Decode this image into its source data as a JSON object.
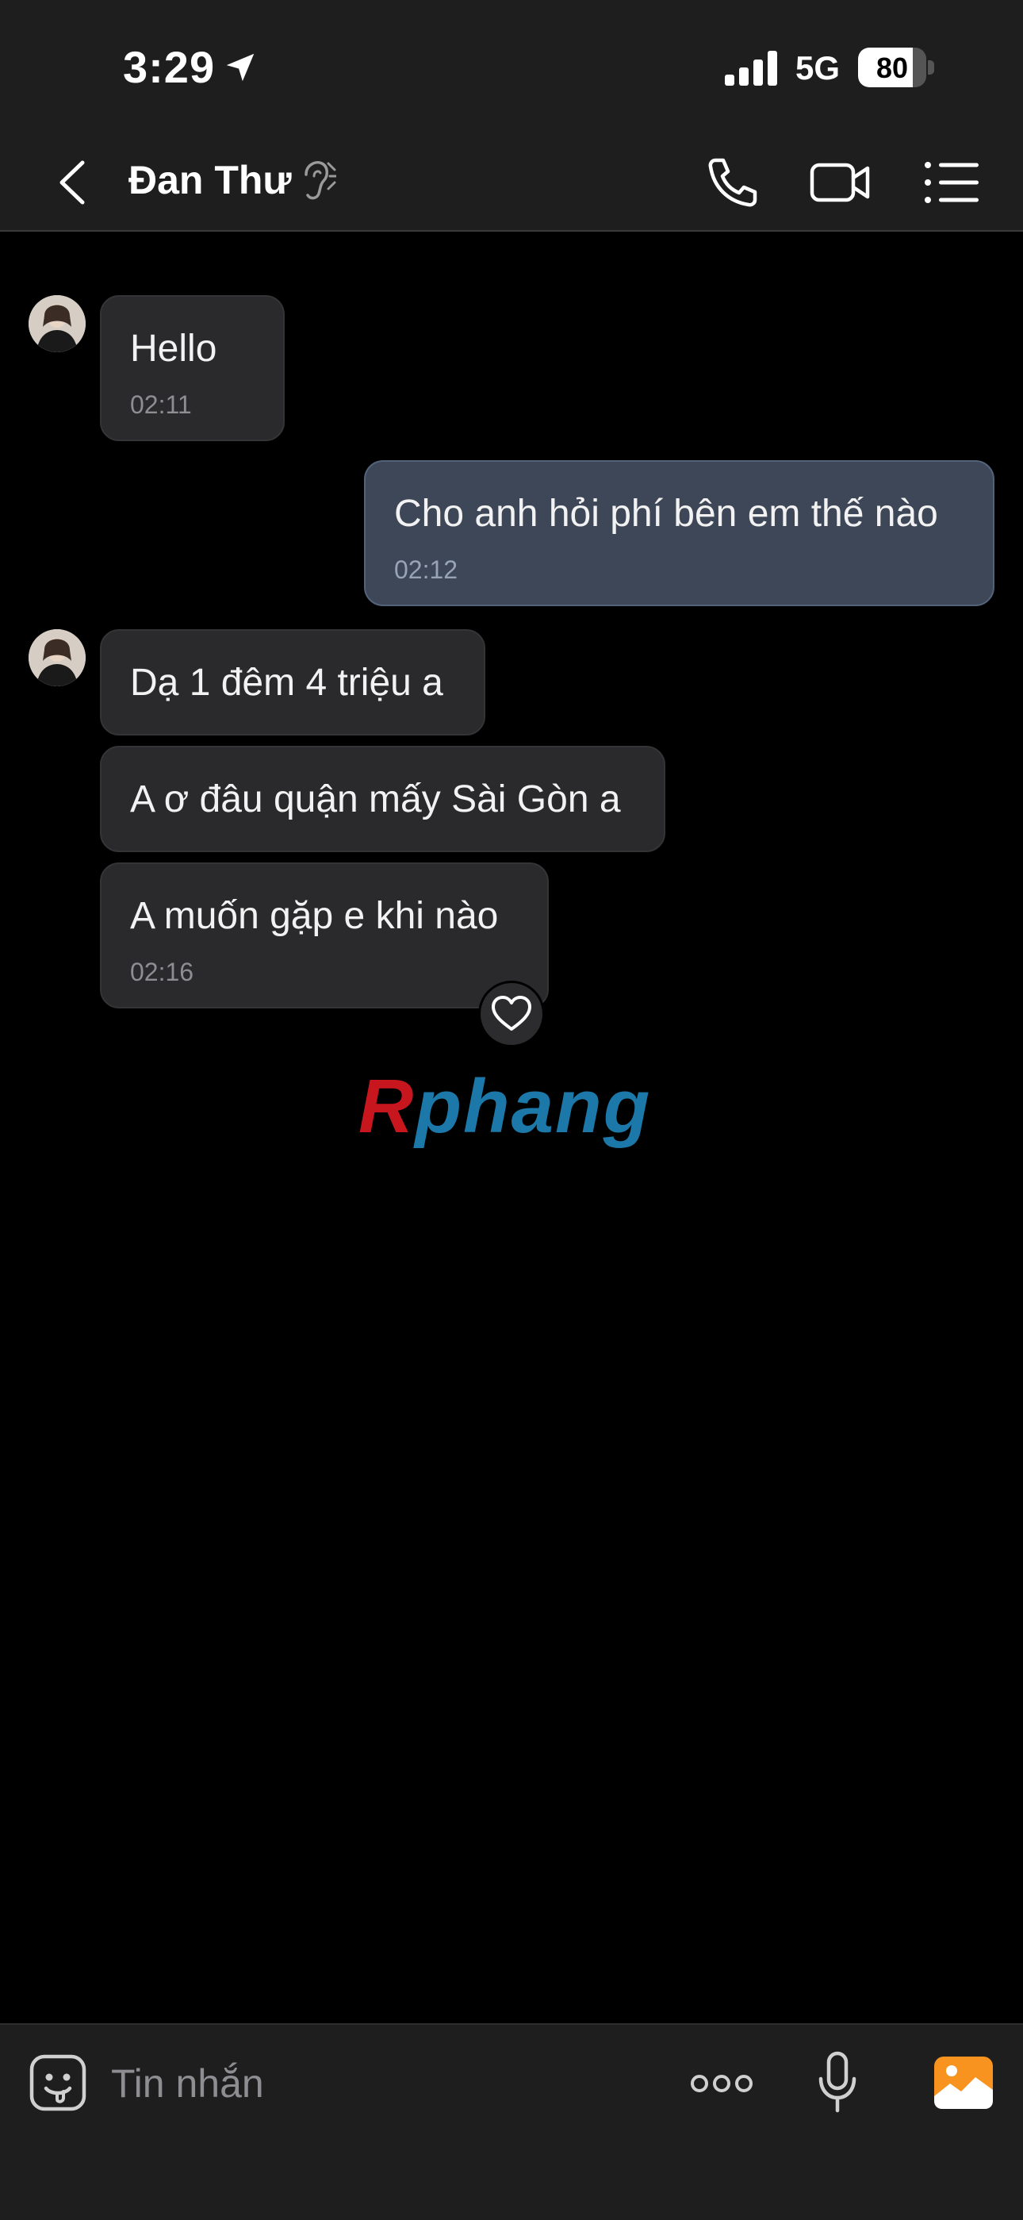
{
  "status_bar": {
    "time": "3:29",
    "network": "5G",
    "battery": "80",
    "battery_level": 0.8
  },
  "header": {
    "contact_name": "Đan Thư"
  },
  "messages": [
    {
      "direction": "in",
      "text": "Hello",
      "time": "02:11"
    },
    {
      "direction": "out",
      "text": "Cho anh hỏi phí bên em thế nào",
      "time": "02:12"
    },
    {
      "direction": "in",
      "text": "Dạ 1 đêm 4 triệu a",
      "time": ""
    },
    {
      "direction": "in",
      "text": "A ơ đâu quận mấy Sài Gòn a",
      "time": ""
    },
    {
      "direction": "in",
      "text": "A muốn gặp e khi nào",
      "time": "02:16"
    }
  ],
  "watermark": {
    "first": "R",
    "rest": "phang"
  },
  "composer": {
    "placeholder": "Tin nhắn"
  },
  "colors": {
    "incoming_bubble": "#2a2a2c",
    "outgoing_bubble": "#3d4757",
    "photo_accent": "#f7931e"
  },
  "icons": [
    "location-arrow-icon",
    "signal-icon",
    "back-icon",
    "hearing-icon",
    "phone-icon",
    "video-camera-icon",
    "list-icon",
    "heart-icon",
    "sticker-icon",
    "more-icon",
    "microphone-icon",
    "photo-icon"
  ]
}
